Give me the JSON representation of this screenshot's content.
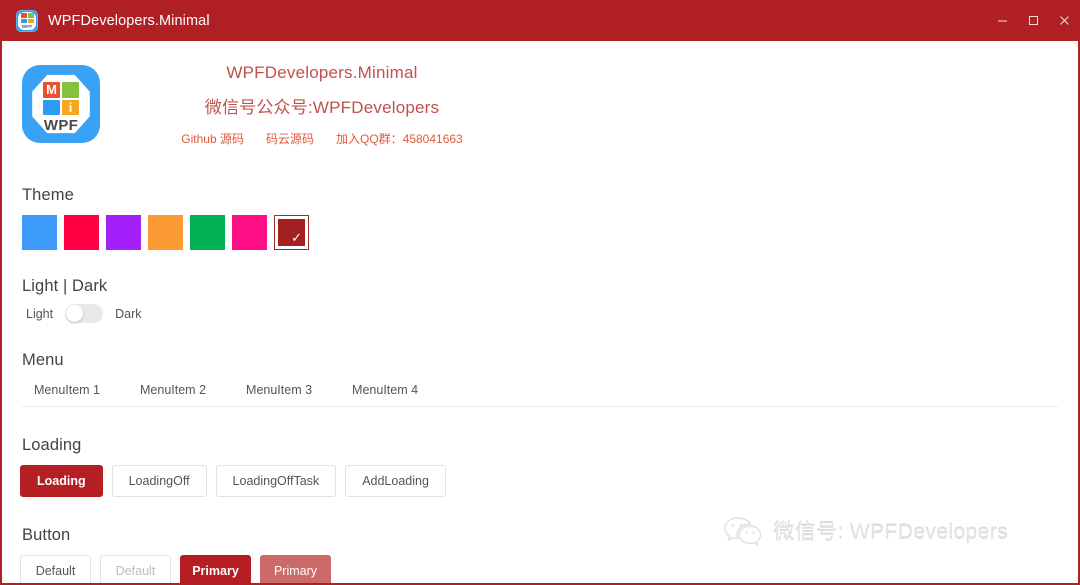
{
  "window": {
    "title": "WPFDevelopers.Minimal",
    "icon": "app-logo-icon",
    "accent_color": "#b01f24",
    "controls": {
      "minimize": "–",
      "maximize": "□",
      "close": "✕"
    }
  },
  "brand": {
    "logo_text": "WPF",
    "logo_tiles": [
      {
        "label": "M",
        "color": "#e8502e"
      },
      {
        "label": "",
        "color": "#84c13f"
      },
      {
        "label": "",
        "color": "#2f9bf0"
      },
      {
        "label": "i",
        "color": "#f5a623"
      }
    ],
    "title": "WPFDevelopers.Minimal",
    "subtitle": "微信号公众号:WPFDevelopers",
    "links": [
      "Github 源码",
      "码云源码",
      "加入QQ群：458041663"
    ],
    "link_color": "#e0593c",
    "text_color": "#c2504e"
  },
  "theme": {
    "heading": "Theme",
    "swatches": [
      {
        "name": "blue",
        "color": "#3e9bfa",
        "selected": false
      },
      {
        "name": "red",
        "color": "#ff0044",
        "selected": false
      },
      {
        "name": "purple",
        "color": "#a420fb",
        "selected": false
      },
      {
        "name": "orange",
        "color": "#fb9a33",
        "selected": false
      },
      {
        "name": "green",
        "color": "#00b253",
        "selected": false
      },
      {
        "name": "magenta",
        "color": "#ff0d84",
        "selected": false
      },
      {
        "name": "darkred",
        "color": "#a52121",
        "selected": true
      }
    ],
    "check_glyph": "✓"
  },
  "light_dark": {
    "heading": "Light | Dark",
    "left_label": "Light",
    "right_label": "Dark",
    "state": "Light"
  },
  "menu": {
    "heading": "Menu",
    "items": [
      "MenuItem 1",
      "MenuItem 2",
      "MenuItem 3",
      "MenuItem 4"
    ]
  },
  "loading": {
    "heading": "Loading",
    "buttons": [
      {
        "label": "Loading",
        "style": "filled"
      },
      {
        "label": "LoadingOff",
        "style": "default"
      },
      {
        "label": "LoadingOffTask",
        "style": "default"
      },
      {
        "label": "AddLoading",
        "style": "default"
      }
    ]
  },
  "button": {
    "heading": "Button",
    "buttons": [
      {
        "label": "Default",
        "style": "default"
      },
      {
        "label": "Default",
        "style": "disabled"
      },
      {
        "label": "Primary",
        "style": "filled"
      },
      {
        "label": "Primary",
        "style": "filled-light"
      }
    ]
  },
  "watermark": {
    "icon": "wechat-icon",
    "text": "微信号: WPFDevelopers"
  }
}
